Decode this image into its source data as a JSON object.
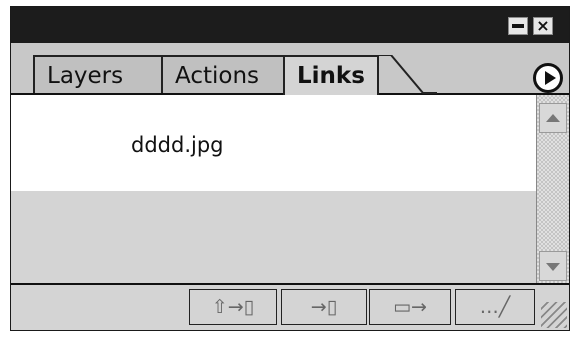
{
  "panel": {
    "tabs": [
      {
        "label": "Layers",
        "active": false
      },
      {
        "label": "Actions",
        "active": false
      },
      {
        "label": "Links",
        "active": true
      }
    ],
    "window_buttons": {
      "minimize_icon": "minimize-icon",
      "close_glyph": "×"
    }
  },
  "links": {
    "items": [
      {
        "name": "dddd.jpg"
      }
    ]
  },
  "toolbar": {
    "buttons": [
      {
        "icon": "relink-icon",
        "glyph": "⇧→▯"
      },
      {
        "icon": "go-to-link-icon",
        "glyph": "→▯"
      },
      {
        "icon": "update-link-icon",
        "glyph": "▭→"
      },
      {
        "icon": "edit-original-icon",
        "glyph": "…╱"
      }
    ]
  },
  "colors": {
    "titlebar": "#1c1c1c",
    "panel_bg": "#d4d4d4",
    "list_row_bg": "#ffffff"
  }
}
